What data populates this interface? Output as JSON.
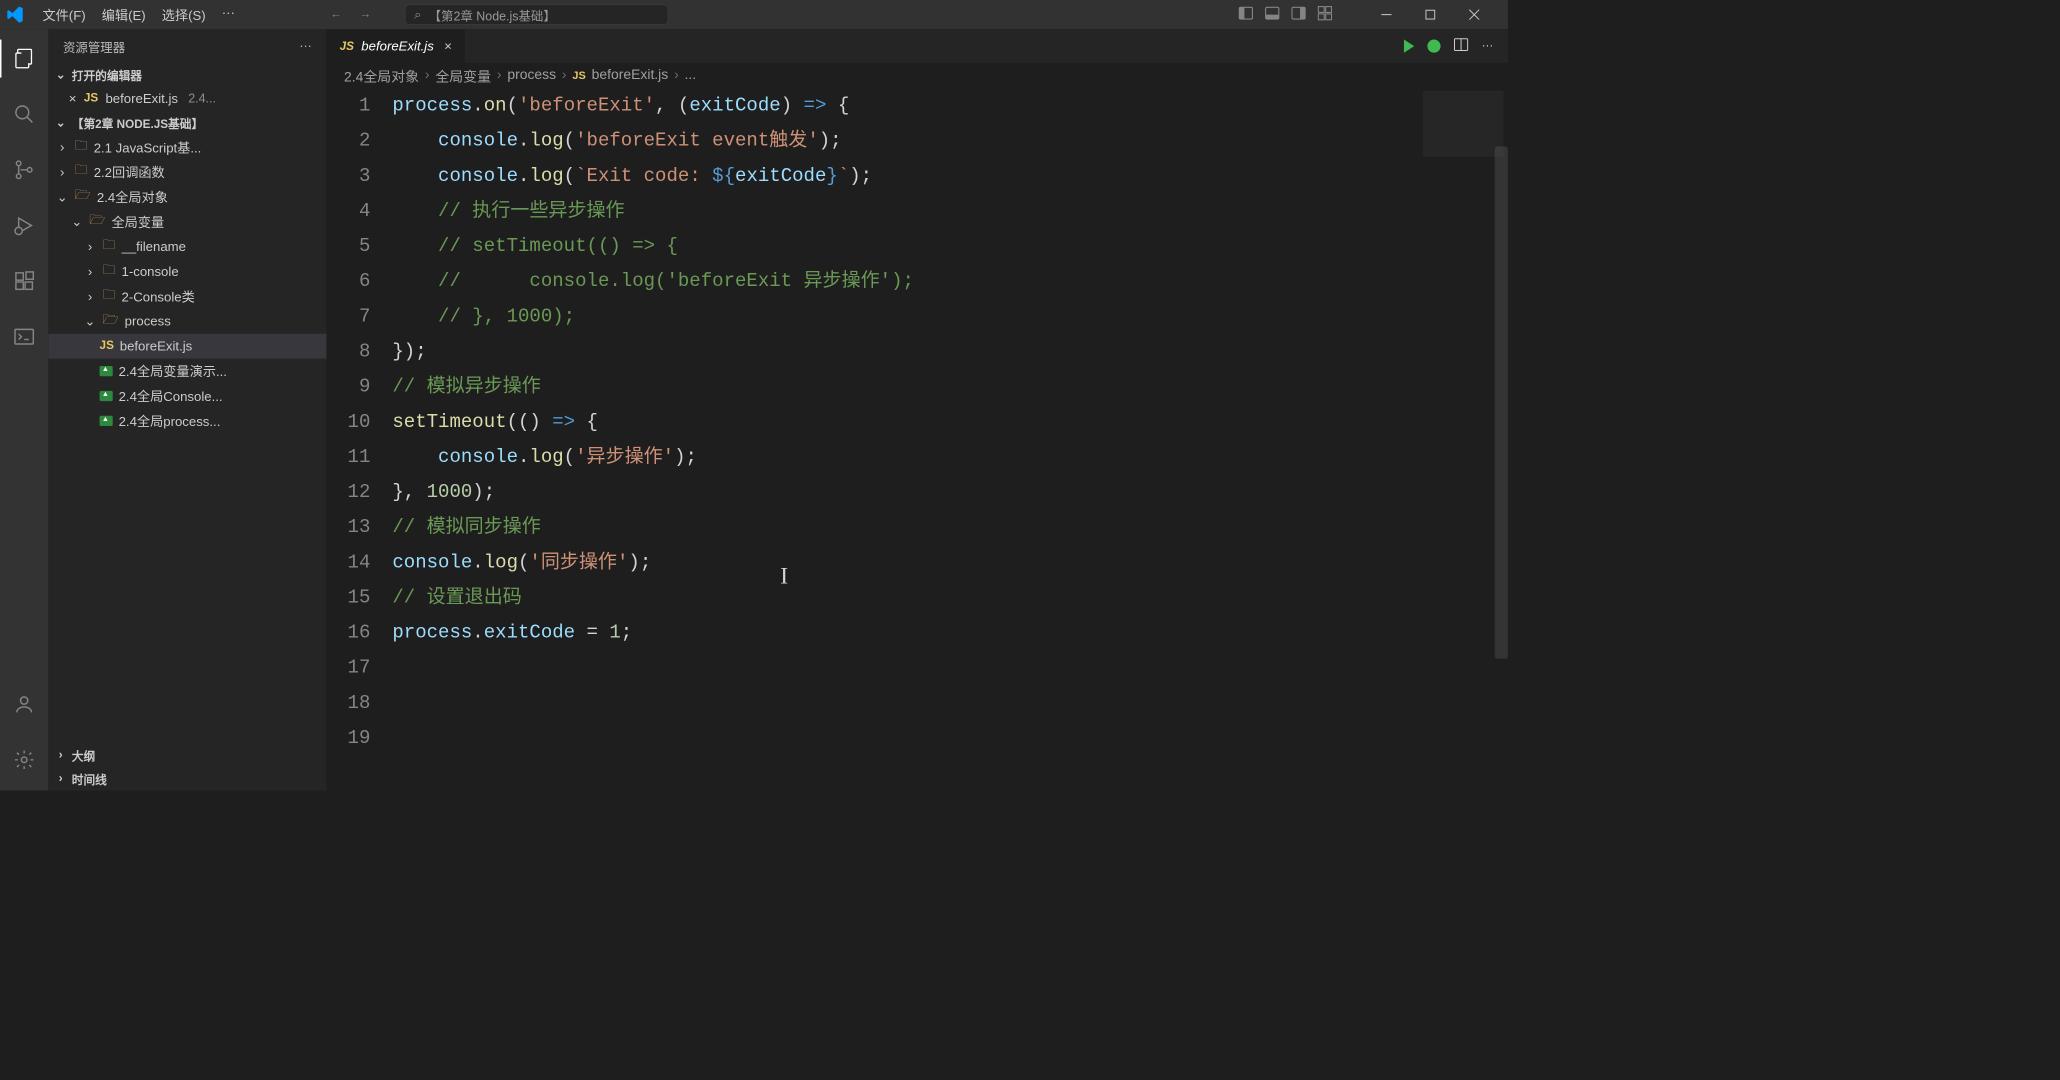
{
  "titlebar": {
    "menus": [
      "文件(F)",
      "编辑(E)",
      "选择(S)",
      "···"
    ],
    "search_placeholder": "【第2章 Node.js基础】"
  },
  "sidebar": {
    "title": "资源管理器",
    "open_editors": "打开的编辑器",
    "open_file": {
      "name": "beforeExit.js",
      "context": "2.4..."
    },
    "workspace": "【第2章 NODE.JS基础】",
    "tree": {
      "n0": "2.1  JavaScript基...",
      "n1": "2.2回调函数",
      "n2": "2.4全局对象",
      "n3": "全局变量",
      "n4": "__filename",
      "n5": "1-console",
      "n6": "2-Console类",
      "n7": "process",
      "n8": "beforeExit.js",
      "n9": "2.4全局变量演示...",
      "n10": "2.4全局Console...",
      "n11": "2.4全局process..."
    },
    "outline": "大纲",
    "timeline": "时间线"
  },
  "tab": {
    "filename": "beforeExit.js"
  },
  "breadcrumb": {
    "b0": "2.4全局对象",
    "b1": "全局变量",
    "b2": "process",
    "b3": "beforeExit.js",
    "b4": "..."
  },
  "code": {
    "l1": "process.on('beforeExit', (exitCode) => {",
    "l2": "    console.log('beforeExit event触发');",
    "l3": "    console.log(`Exit code: ${exitCode}`);",
    "l4": "    // 执行一些异步操作",
    "l5": "    // setTimeout(() => {",
    "l6": "    //      console.log('beforeExit 异步操作');",
    "l7": "    // }, 1000);",
    "l8": "});",
    "l9": "",
    "l10": "// 模拟异步操作",
    "l11": "setTimeout(() => {",
    "l12": "    console.log('异步操作');",
    "l13": "}, 1000);",
    "l14": "",
    "l15": "// 模拟同步操作",
    "l16": "console.log('同步操作');",
    "l17": "",
    "l18": "// 设置退出码",
    "l19": "process.exitCode = 1;"
  },
  "line_numbers": [
    "1",
    "2",
    "3",
    "4",
    "5",
    "6",
    "7",
    "8",
    "9",
    "10",
    "11",
    "12",
    "13",
    "14",
    "15",
    "16",
    "17",
    "18",
    "19"
  ]
}
